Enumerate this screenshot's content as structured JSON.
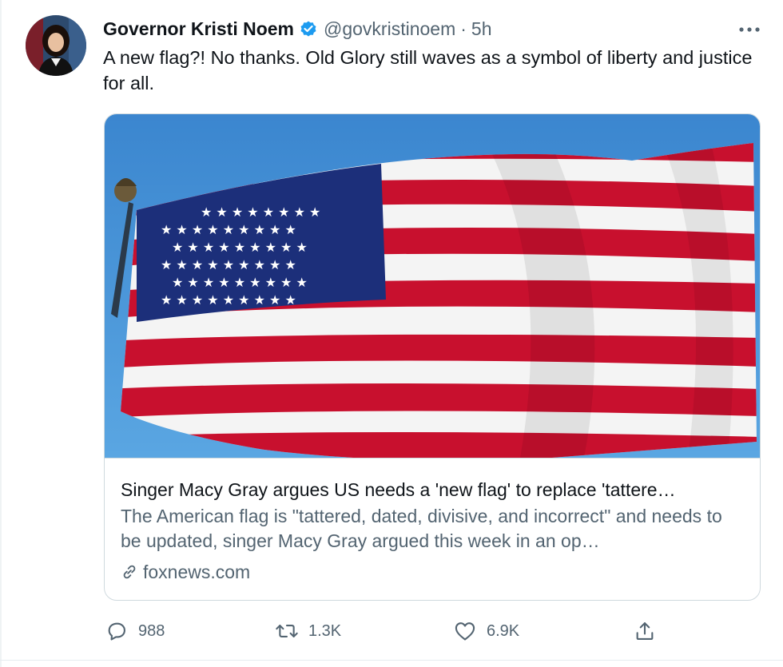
{
  "author": {
    "name": "Governor Kristi Noem",
    "handle": "@govkristinoem",
    "separator": "·",
    "time": "5h",
    "verified": true
  },
  "tweet": {
    "text": "A new flag?! No thanks. Old Glory still waves as a symbol of liberty and justice for all."
  },
  "card": {
    "title": "Singer Macy Gray argues US needs a 'new flag' to replace 'tattere…",
    "description": "The American flag is \"tattered, dated, divisive, and incorrect\" and needs to be updated, singer Macy Gray argued this week in an op…",
    "domain": "foxnews.com",
    "image_subject": "american-flag-waving"
  },
  "actions": {
    "reply_count": "988",
    "retweet_count": "1.3K",
    "like_count": "6.9K"
  },
  "icons": {
    "verified": "verified-badge-icon",
    "more": "more-options-icon",
    "reply": "reply-icon",
    "retweet": "retweet-icon",
    "like": "like-icon",
    "share": "share-icon",
    "link": "link-icon"
  },
  "colors": {
    "text_primary": "#0f1419",
    "text_secondary": "#536471",
    "verified_blue": "#1d9bf0",
    "border": "#cfd9de",
    "flag_red": "#c8102e",
    "flag_blue": "#1c2f7a",
    "sky_blue": "#3c8fd6"
  }
}
